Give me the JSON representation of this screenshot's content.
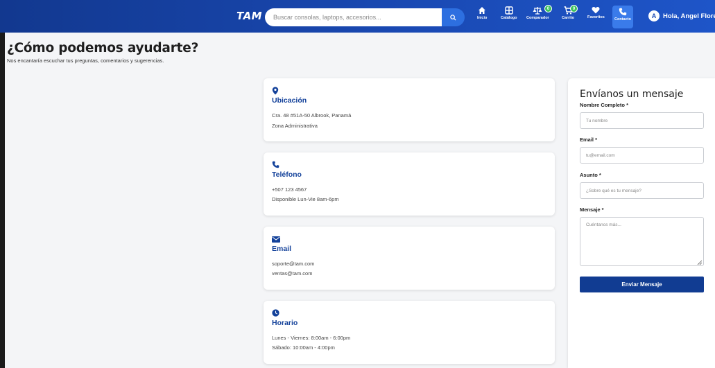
{
  "header": {
    "logo": "TAM",
    "search_placeholder": "Buscar consolas, laptops, accesorios...",
    "nav": [
      {
        "label": "Inicio",
        "icon": "home-icon"
      },
      {
        "label": "Catálogo",
        "icon": "grid-icon"
      },
      {
        "label": "Comparador",
        "icon": "scale-icon",
        "badge": "0"
      },
      {
        "label": "Carrito",
        "icon": "cart-icon",
        "badge": "0"
      },
      {
        "label": "Favoritos",
        "icon": "heart-icon"
      },
      {
        "label": "Contacto",
        "icon": "phone-icon"
      }
    ],
    "user_initial": "A",
    "user_greeting": "Hola, Angel Florez"
  },
  "page": {
    "title": "¿Cómo podemos ayudarte?",
    "subtitle": "Nos encantaría escuchar tus preguntas, comentarios y sugerencias."
  },
  "cards": [
    {
      "title": "Ubicación",
      "icon": "location-pin-icon",
      "lines": [
        "Cra. 48 #51A-50 Albrook, Panamá",
        "Zona Administrativa"
      ]
    },
    {
      "title": "Teléfono",
      "icon": "phone-icon",
      "lines": [
        "+507 123 4567",
        "Disponible Lun-Vie 8am-6pm"
      ]
    },
    {
      "title": "Email",
      "icon": "envelope-icon",
      "lines": [
        "soporte@tam.com",
        "ventas@tam.com"
      ]
    },
    {
      "title": "Horario",
      "icon": "clock-icon",
      "lines": [
        "Lunes - Viernes: 8:00am - 6:00pm",
        "Sábado: 10:00am - 4:00pm"
      ]
    }
  ],
  "form": {
    "title": "Envíanos un mensaje",
    "name_label": "Nombre Completo *",
    "name_placeholder": "Tu nombre",
    "email_label": "Email *",
    "email_placeholder": "tu@email.com",
    "subject_label": "Asunto *",
    "subject_placeholder": "¿Sobre qué es tu mensaje?",
    "message_label": "Mensaje *",
    "message_placeholder": "Cuéntanos más...",
    "submit_label": "Enviar Mensaje"
  },
  "colors": {
    "primary": "#1a4ab5",
    "dark_primary": "#113c92",
    "accent_badge": "#3cc15c"
  }
}
